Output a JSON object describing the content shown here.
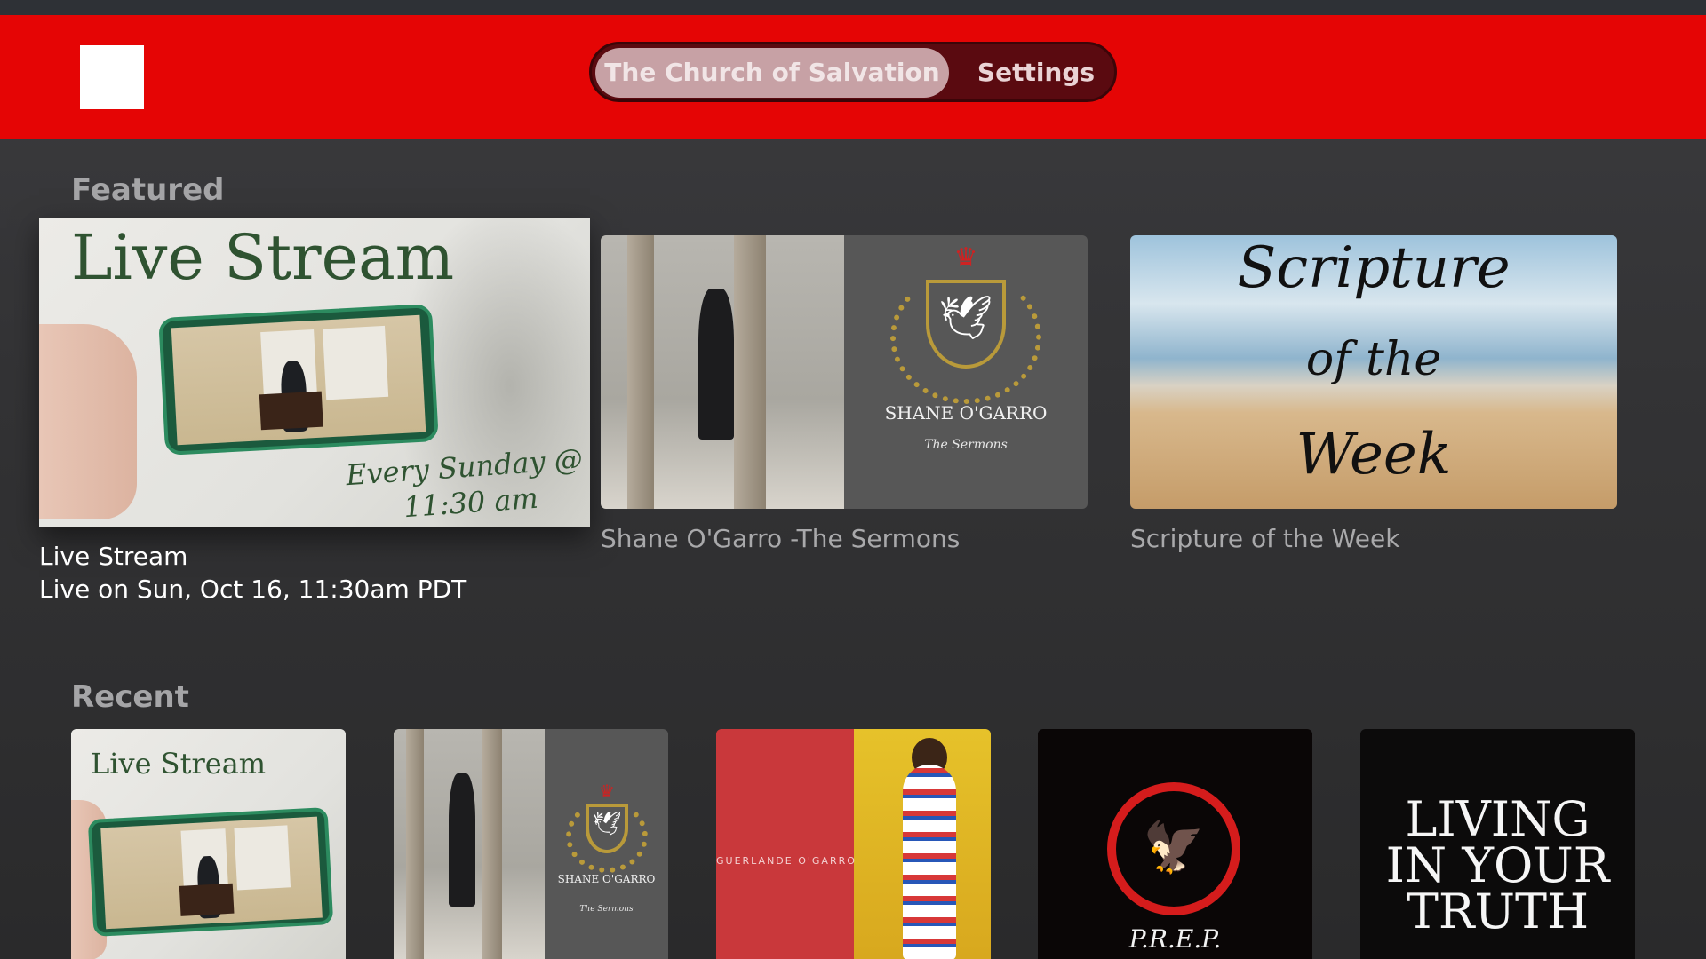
{
  "header": {
    "nav": [
      {
        "label": "The Church of Salvation",
        "selected": true
      },
      {
        "label": "Settings",
        "selected": false
      }
    ]
  },
  "featured": {
    "title": "Featured",
    "items": [
      {
        "caption": "Live Stream",
        "subcaption": "Live on Sun, Oct 16, 11:30am PDT",
        "art_title": "Live Stream",
        "art_script_1": "Every Sunday @",
        "art_script_2": "11:30 am"
      },
      {
        "caption": "Shane O'Garro -The Sermons",
        "art_name": "SHANE O'GARRO",
        "art_sub": "The Sermons"
      },
      {
        "caption": "Scripture of the Week",
        "art_l1": "Scripture",
        "art_l2": "of the",
        "art_l3": "Week"
      }
    ]
  },
  "recent": {
    "title": "Recent",
    "items": [
      {
        "art_title": "Live Stream"
      },
      {
        "art_name": "SHANE O'GARRO",
        "art_sub": "The Sermons"
      },
      {
        "art_label": "GUERLANDE O'GARRO"
      },
      {
        "art_label": "P.R.E.P."
      },
      {
        "art_l1": "LIVING",
        "art_l2": "IN YOUR",
        "art_l3": "TRUTH"
      }
    ]
  },
  "colors": {
    "header": "#e50505",
    "background": "#333335"
  }
}
